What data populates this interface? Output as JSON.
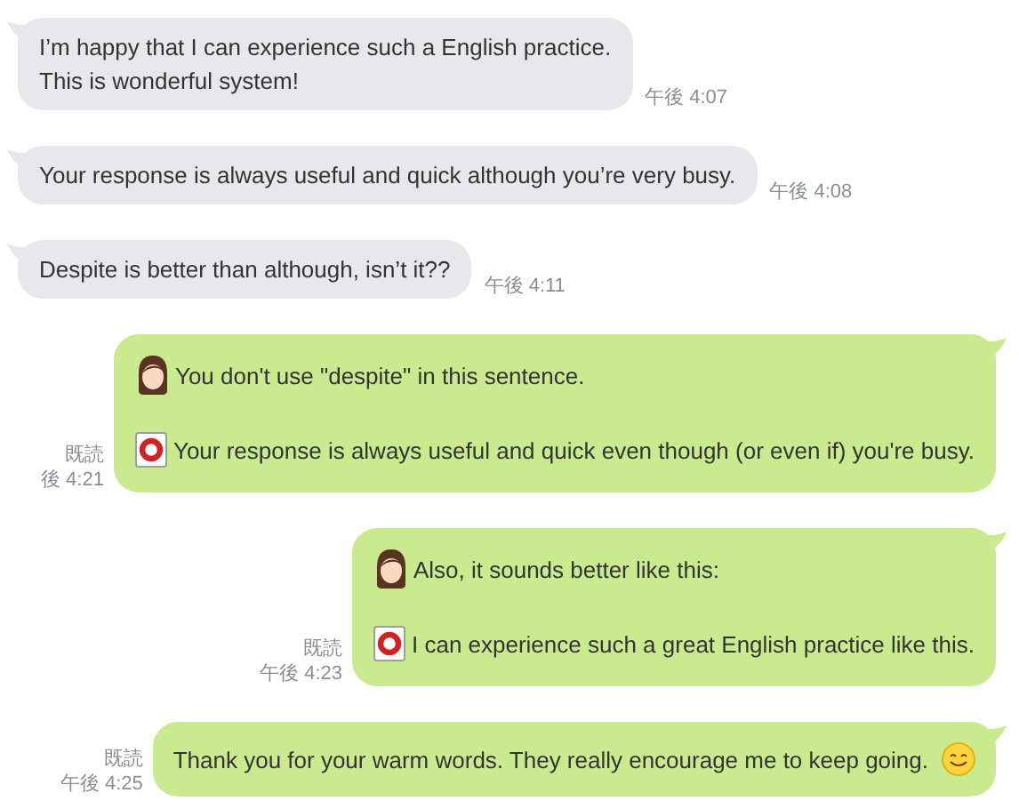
{
  "messages": [
    {
      "kind": "incoming",
      "lines": [
        {
          "kind": "plain",
          "text": "I’m happy that I can experience such a English practice."
        },
        {
          "kind": "plain",
          "text": "This is wonderful system!"
        }
      ],
      "time": "午後 4:07"
    },
    {
      "kind": "incoming",
      "lines": [
        {
          "kind": "plain",
          "text": "Your response is always useful and quick although you’re very busy."
        }
      ],
      "time": "午後 4:08"
    },
    {
      "kind": "incoming",
      "lines": [
        {
          "kind": "plain",
          "text": "Despite is better than although, isn’t it??"
        }
      ],
      "time": "午後 4:11"
    },
    {
      "kind": "outgoing",
      "read": "既読",
      "time": "後 4:21",
      "lines": [
        {
          "kind": "teacher",
          "text": "You don't use \"despite\" in this sentence."
        },
        {
          "kind": "correction",
          "text": "Your response is always useful and quick even though (or even if) you're busy."
        }
      ]
    },
    {
      "kind": "outgoing",
      "read": "既読",
      "time": "午後 4:23",
      "lines": [
        {
          "kind": "teacher",
          "text": "Also, it sounds better like this:"
        },
        {
          "kind": "correction",
          "text": "I can experience such a great English practice like this."
        }
      ]
    },
    {
      "kind": "outgoing",
      "read": "既読",
      "time": "午後 4:25",
      "lines": [
        {
          "kind": "smile",
          "text": "Thank you for your warm words. They really encourage me to keep going."
        }
      ]
    }
  ]
}
